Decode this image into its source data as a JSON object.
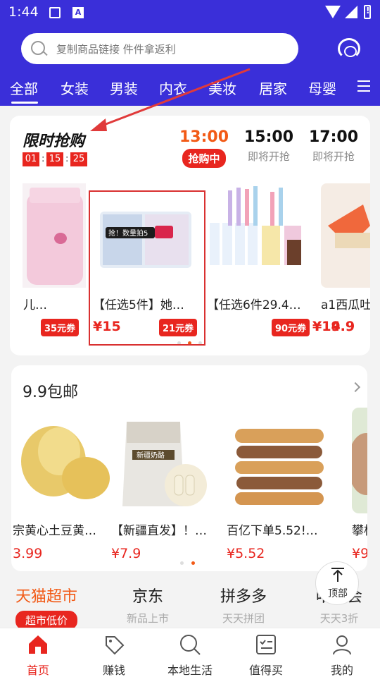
{
  "status_bar": {
    "time": "1:44"
  },
  "search": {
    "placeholder": "复制商品链接 件件拿返利"
  },
  "categories": [
    "全部",
    "女装",
    "男装",
    "内衣",
    "美妆",
    "居家",
    "母婴"
  ],
  "flash_sale": {
    "title": "限时抢购",
    "countdown": [
      "01",
      "15",
      "25"
    ],
    "sessions": [
      {
        "time": "13:00",
        "status": "抢购中"
      },
      {
        "time": "15:00",
        "status": "即将开抢"
      },
      {
        "time": "17:00",
        "status": "即将开抢"
      }
    ],
    "products": [
      {
        "name": "装】婴儿…",
        "price": "",
        "coupon": "35元券"
      },
      {
        "name": "【任选5件】她…",
        "price": "¥15",
        "coupon": "21元券"
      },
      {
        "name": "【任选6件29.4…",
        "price": "¥19.9",
        "coupon": "90元券"
      },
      {
        "name": "a1西瓜吐",
        "price": "¥14.9",
        "coupon": ""
      }
    ],
    "promo_tag": "抢！数量拍5"
  },
  "nine_nine": {
    "title": "9.9包邮",
    "products": [
      {
        "name": "宗黄心土豆黄…",
        "price": "3.99"
      },
      {
        "name": "【新疆直发】！…",
        "price": "¥7.9"
      },
      {
        "name": "百亿下单5.52!…",
        "price": "¥5.52"
      },
      {
        "name": "攀枝",
        "price": "¥9"
      }
    ],
    "bag_label": "新疆奶酪"
  },
  "channels": [
    {
      "name": "天猫超市",
      "sub": "超市低价"
    },
    {
      "name": "京东",
      "sub": "新品上市"
    },
    {
      "name": "拼多多",
      "sub": "天天拼团"
    },
    {
      "name": "唯品会",
      "sub": "天天3折"
    }
  ],
  "top_button": {
    "label": "顶部"
  },
  "bottom_nav": [
    "首页",
    "赚钱",
    "本地生活",
    "值得买",
    "我的"
  ],
  "colors": {
    "brand": "#3a2fd9",
    "accent": "#e8261f",
    "orange": "#f25a16"
  }
}
